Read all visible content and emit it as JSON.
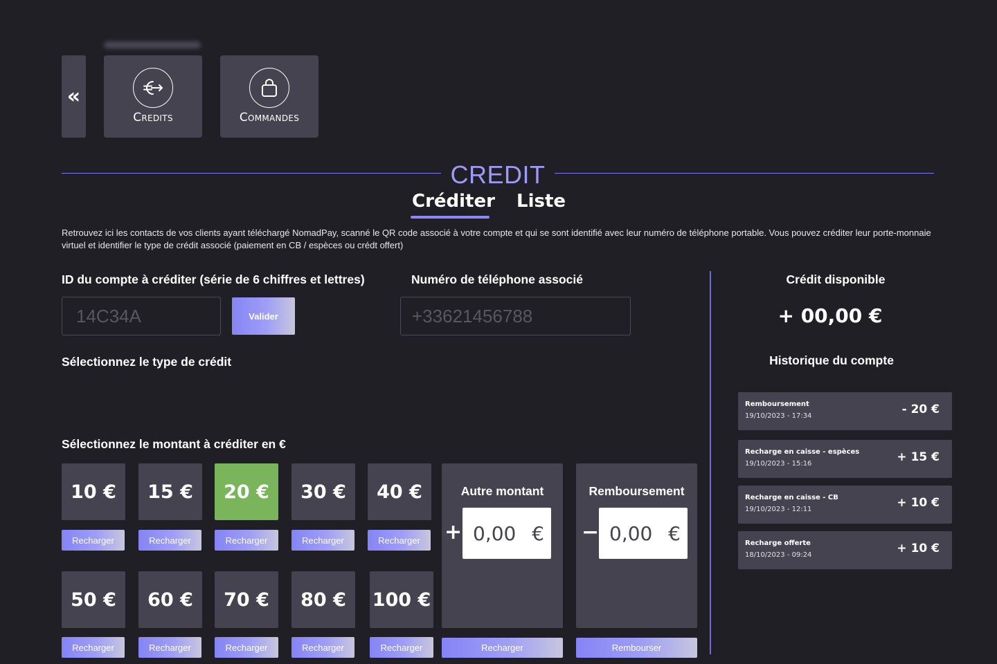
{
  "nav": {
    "back_symbol": "«",
    "credits_label": "Credits",
    "commandes_label": "Commandes"
  },
  "section": {
    "title": "CREDIT",
    "tabs": [
      {
        "label": "Créditer",
        "active": true
      },
      {
        "label": "Liste",
        "active": false
      }
    ],
    "description": "Retrouvez ici les contacts de vos clients ayant téléchargé NomadPay, scanné le QR code associé à votre compte et qui se sont identifié avec leur  numéro de téléphone portable. Vous pouvez créditer leur porte-monnaie virtuel et identifier le type de crédit associé (paiement en CB / espèces ou crédt offert)"
  },
  "form": {
    "account_id_label": "ID du compte à créditer (série de 6 chiffres et lettres)",
    "account_id_placeholder": "14C34A",
    "validate_label": "Valider",
    "phone_label": "Numéro de téléphone associé",
    "phone_placeholder": "+33621456788",
    "credit_type_label": "Sélectionnez le type de crédit",
    "amount_label": "Sélectionnez le montant à créditer en €"
  },
  "amounts": [
    {
      "value": "10 €",
      "button": "Recharger",
      "selected": false
    },
    {
      "value": "15 €",
      "button": "Recharger",
      "selected": false
    },
    {
      "value": "20 €",
      "button": "Recharger",
      "selected": true
    },
    {
      "value": "30 €",
      "button": "Recharger",
      "selected": false
    },
    {
      "value": "40 €",
      "button": "Recharger",
      "selected": false
    },
    {
      "value": "50 €",
      "button": "Recharger",
      "selected": false
    },
    {
      "value": "60 €",
      "button": "Recharger",
      "selected": false
    },
    {
      "value": "70 €",
      "button": "Recharger",
      "selected": false
    },
    {
      "value": "80 €",
      "button": "Recharger",
      "selected": false
    },
    {
      "value": "100 €",
      "button": "Recharger",
      "selected": false
    }
  ],
  "custom_amount": {
    "title": "Autre montant",
    "sign": "+",
    "value": "0,00",
    "currency": "€",
    "button": "Recharger"
  },
  "refund": {
    "title": "Remboursement",
    "sign": "−",
    "value": "0,00",
    "currency": "€",
    "button": "Rembourser"
  },
  "balance": {
    "title": "Crédit disponible",
    "value": "+ 00,00 €"
  },
  "history": {
    "title": "Historique du compte",
    "items": [
      {
        "type": "Remboursement",
        "date": "19/10/2023 - 17:34",
        "amount": "- 20 €"
      },
      {
        "type": "Recharge en caisse - espèces",
        "date": "19/10/2023 - 15:16",
        "amount": "+ 15 €"
      },
      {
        "type": "Recharge en caisse - CB",
        "date": "19/10/2023 - 12:11",
        "amount": "+ 10 €"
      },
      {
        "type": "Recharge offerte",
        "date": "18/10/2023 - 09:24",
        "amount": "+ 10 €"
      }
    ]
  },
  "colors": {
    "background": "#211f26",
    "card": "#45434f",
    "accent": "#8584f5",
    "title": "#9c9bf7",
    "selected": "#7ab55c"
  }
}
